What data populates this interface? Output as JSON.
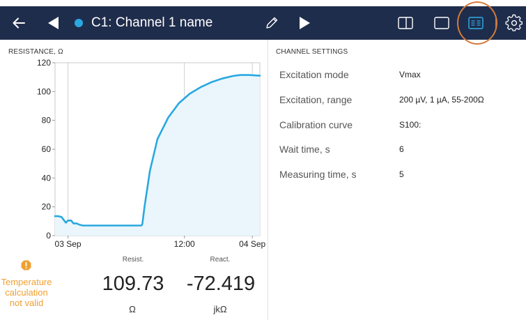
{
  "header": {
    "channel_title": "C1: Channel 1 name",
    "channel_color": "#29a8e0",
    "bar_color": "#1f2d4c",
    "icons": [
      "back-arrow-icon",
      "previous-channel-icon",
      "edit-pencil-icon",
      "next-channel-icon",
      "split-view-icon",
      "single-view-icon",
      "settings-view-icon",
      "gear-icon"
    ]
  },
  "chart": {
    "title": "RESISTANCE, Ω",
    "line_color": "#29a8e0",
    "fill_color": "#eaf6fc"
  },
  "chart_data": {
    "type": "area",
    "title": "RESISTANCE, Ω",
    "xlabel": "",
    "ylabel": "",
    "ylim": [
      0,
      120
    ],
    "yticks": [
      0,
      20,
      40,
      60,
      80,
      100,
      120
    ],
    "xtick_labels": [
      "03 Sep",
      "12:00",
      "04 Sep"
    ],
    "grid": true,
    "series": [
      {
        "values": [
          [
            0,
            13.5
          ],
          [
            3,
            13.5
          ],
          [
            6,
            13
          ],
          [
            8,
            11
          ],
          [
            10,
            9
          ],
          [
            12,
            10.5
          ],
          [
            15,
            10.5
          ],
          [
            17,
            8.5
          ],
          [
            20,
            8.5
          ],
          [
            23,
            7.5
          ],
          [
            26,
            7
          ],
          [
            40,
            7
          ],
          [
            60,
            7
          ],
          [
            75,
            7
          ],
          [
            80,
            7
          ],
          [
            81,
            8
          ],
          [
            83,
            20
          ],
          [
            88,
            45
          ],
          [
            95,
            67
          ],
          [
            105,
            82
          ],
          [
            115,
            92
          ],
          [
            125,
            98.5
          ],
          [
            135,
            103
          ],
          [
            145,
            106.5
          ],
          [
            155,
            109
          ],
          [
            165,
            110.8
          ],
          [
            172,
            111.5
          ],
          [
            180,
            111.5
          ],
          [
            190,
            111
          ]
        ]
      }
    ]
  },
  "readouts": {
    "resist_label": "Resist.",
    "resist_value": "109.73",
    "resist_unit": "Ω",
    "react_label": "React.",
    "react_value": "-72.419",
    "react_unit": "jkΩ"
  },
  "warning": {
    "line1": "Temperature",
    "line2": "calculation",
    "line3": "not valid",
    "color": "#f0a030"
  },
  "settings": {
    "title": "CHANNEL SETTINGS",
    "rows": [
      {
        "label": "Excitation mode",
        "value": "Vmax"
      },
      {
        "label": "Excitation, range",
        "value": "200 µV, 1 µA, 55-200Ω"
      },
      {
        "label": "Calibration curve",
        "value": "S100:"
      },
      {
        "label": "Wait time, s",
        "value": "6"
      },
      {
        "label": "Measuring time, s",
        "value": "5"
      }
    ]
  }
}
